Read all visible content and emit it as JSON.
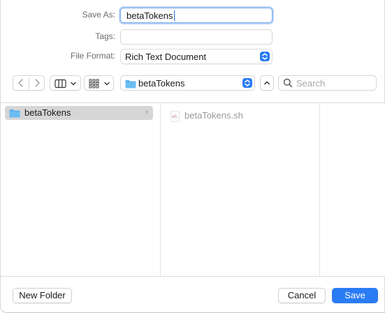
{
  "form": {
    "save_as_label": "Save As:",
    "save_as_value": "betaTokens",
    "tags_label": "Tags:",
    "tags_value": "",
    "file_format_label": "File Format:",
    "file_format_value": "Rich Text Document"
  },
  "toolbar": {
    "location": "betaTokens",
    "search_placeholder": "Search"
  },
  "browser": {
    "column1_selected": "betaTokens",
    "column2_files": [
      {
        "name": "betaTokens.sh",
        "badge": "sh"
      }
    ]
  },
  "footer": {
    "new_folder_label": "New Folder",
    "cancel_label": "Cancel",
    "save_label": "Save"
  },
  "colors": {
    "accent": "#2a7cf4",
    "folder": "#5ab0ee",
    "selection": "#d6d6d6"
  },
  "icons": [
    "back-icon",
    "forward-icon",
    "columns-view-icon",
    "grid-view-icon",
    "folder-icon",
    "chevron-up-icon",
    "search-icon",
    "file-sh-icon"
  ]
}
